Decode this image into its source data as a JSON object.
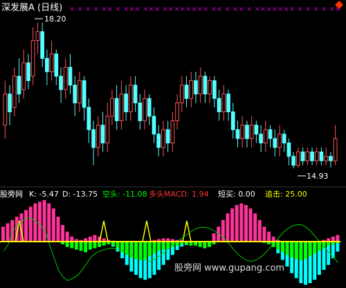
{
  "upper_panel": {
    "title": "深发展A (日线)",
    "high_label": "18.20",
    "low_label": "14.93",
    "markers": "× × × ×   ×× × ××× ××× ×××××××× ××  × ×× × ××××××× × × × × ××",
    "menu_icon": "diamond-menu-icon",
    "candles": [
      {
        "o": 15.9,
        "c": 16.6,
        "h": 16.9,
        "l": 15.6,
        "up": true
      },
      {
        "o": 16.6,
        "c": 16.2,
        "h": 16.8,
        "l": 15.9,
        "up": false
      },
      {
        "o": 16.3,
        "c": 17.0,
        "h": 17.2,
        "l": 16.1,
        "up": true
      },
      {
        "o": 17.0,
        "c": 16.6,
        "h": 17.4,
        "l": 16.4,
        "up": false
      },
      {
        "o": 16.7,
        "c": 17.3,
        "h": 17.6,
        "l": 16.5,
        "up": true
      },
      {
        "o": 17.3,
        "c": 16.9,
        "h": 17.5,
        "l": 16.7,
        "up": false
      },
      {
        "o": 17.0,
        "c": 17.8,
        "h": 18.1,
        "l": 16.8,
        "up": true
      },
      {
        "o": 17.8,
        "c": 18.0,
        "h": 18.2,
        "l": 17.5,
        "up": true
      },
      {
        "o": 18.0,
        "c": 17.4,
        "h": 18.2,
        "l": 17.2,
        "up": false
      },
      {
        "o": 17.4,
        "c": 17.1,
        "h": 17.6,
        "l": 16.8,
        "up": false
      },
      {
        "o": 17.1,
        "c": 17.5,
        "h": 17.8,
        "l": 16.9,
        "up": true
      },
      {
        "o": 17.5,
        "c": 17.0,
        "h": 17.6,
        "l": 16.8,
        "up": false
      },
      {
        "o": 17.0,
        "c": 16.7,
        "h": 17.2,
        "l": 16.4,
        "up": false
      },
      {
        "o": 16.7,
        "c": 17.2,
        "h": 17.4,
        "l": 16.5,
        "up": true
      },
      {
        "o": 17.2,
        "c": 16.8,
        "h": 17.5,
        "l": 16.6,
        "up": false
      },
      {
        "o": 16.8,
        "c": 16.4,
        "h": 17.0,
        "l": 16.1,
        "up": false
      },
      {
        "o": 16.4,
        "c": 16.9,
        "h": 17.1,
        "l": 16.2,
        "up": true
      },
      {
        "o": 16.9,
        "c": 16.3,
        "h": 17.0,
        "l": 16.0,
        "up": false
      },
      {
        "o": 16.3,
        "c": 15.8,
        "h": 16.5,
        "l": 15.5,
        "up": false
      },
      {
        "o": 15.8,
        "c": 15.4,
        "h": 16.0,
        "l": 15.0,
        "up": false
      },
      {
        "o": 15.4,
        "c": 15.9,
        "h": 16.1,
        "l": 15.2,
        "up": true
      },
      {
        "o": 15.9,
        "c": 15.5,
        "h": 16.2,
        "l": 15.3,
        "up": false
      },
      {
        "o": 15.5,
        "c": 16.1,
        "h": 16.4,
        "l": 15.3,
        "up": true
      },
      {
        "o": 16.1,
        "c": 16.5,
        "h": 16.7,
        "l": 15.9,
        "up": true
      },
      {
        "o": 16.5,
        "c": 16.0,
        "h": 16.8,
        "l": 15.8,
        "up": false
      },
      {
        "o": 16.0,
        "c": 16.6,
        "h": 16.9,
        "l": 15.8,
        "up": true
      },
      {
        "o": 16.6,
        "c": 16.2,
        "h": 16.8,
        "l": 16.0,
        "up": false
      },
      {
        "o": 16.2,
        "c": 16.8,
        "h": 17.0,
        "l": 16.0,
        "up": true
      },
      {
        "o": 16.8,
        "c": 16.4,
        "h": 17.0,
        "l": 16.2,
        "up": false
      },
      {
        "o": 16.4,
        "c": 16.0,
        "h": 16.6,
        "l": 15.8,
        "up": false
      },
      {
        "o": 16.0,
        "c": 16.5,
        "h": 16.7,
        "l": 15.8,
        "up": true
      },
      {
        "o": 16.5,
        "c": 16.1,
        "h": 16.6,
        "l": 15.9,
        "up": false
      },
      {
        "o": 16.1,
        "c": 15.7,
        "h": 16.3,
        "l": 15.5,
        "up": false
      },
      {
        "o": 15.7,
        "c": 15.4,
        "h": 15.9,
        "l": 15.2,
        "up": false
      },
      {
        "o": 15.4,
        "c": 15.8,
        "h": 16.0,
        "l": 15.2,
        "up": true
      },
      {
        "o": 15.8,
        "c": 15.5,
        "h": 16.0,
        "l": 15.3,
        "up": false
      },
      {
        "o": 15.5,
        "c": 16.0,
        "h": 16.2,
        "l": 15.3,
        "up": true
      },
      {
        "o": 16.0,
        "c": 16.4,
        "h": 16.6,
        "l": 15.8,
        "up": true
      },
      {
        "o": 16.4,
        "c": 16.8,
        "h": 17.0,
        "l": 16.2,
        "up": true
      },
      {
        "o": 16.8,
        "c": 16.5,
        "h": 17.0,
        "l": 16.3,
        "up": false
      },
      {
        "o": 16.5,
        "c": 16.9,
        "h": 17.1,
        "l": 16.3,
        "up": true
      },
      {
        "o": 16.9,
        "c": 16.6,
        "h": 17.1,
        "l": 16.4,
        "up": false
      },
      {
        "o": 16.6,
        "c": 17.0,
        "h": 17.2,
        "l": 16.4,
        "up": true
      },
      {
        "o": 17.0,
        "c": 16.6,
        "h": 17.1,
        "l": 16.4,
        "up": false
      },
      {
        "o": 16.6,
        "c": 16.9,
        "h": 17.0,
        "l": 16.4,
        "up": true
      },
      {
        "o": 16.9,
        "c": 16.5,
        "h": 17.0,
        "l": 16.3,
        "up": false
      },
      {
        "o": 16.5,
        "c": 16.2,
        "h": 16.7,
        "l": 16.0,
        "up": false
      },
      {
        "o": 16.2,
        "c": 16.6,
        "h": 16.8,
        "l": 16.0,
        "up": true
      },
      {
        "o": 16.6,
        "c": 16.2,
        "h": 16.7,
        "l": 16.0,
        "up": false
      },
      {
        "o": 16.2,
        "c": 15.8,
        "h": 16.4,
        "l": 15.6,
        "up": false
      },
      {
        "o": 15.8,
        "c": 15.6,
        "h": 16.0,
        "l": 15.4,
        "up": false
      },
      {
        "o": 15.6,
        "c": 15.9,
        "h": 16.1,
        "l": 15.4,
        "up": true
      },
      {
        "o": 15.9,
        "c": 15.6,
        "h": 16.0,
        "l": 15.4,
        "up": false
      },
      {
        "o": 15.6,
        "c": 15.9,
        "h": 16.1,
        "l": 15.4,
        "up": true
      },
      {
        "o": 15.9,
        "c": 15.7,
        "h": 16.0,
        "l": 15.5,
        "up": false
      },
      {
        "o": 15.7,
        "c": 15.5,
        "h": 15.9,
        "l": 15.3,
        "up": false
      },
      {
        "o": 15.5,
        "c": 15.8,
        "h": 16.0,
        "l": 15.3,
        "up": true
      },
      {
        "o": 15.8,
        "c": 15.6,
        "h": 15.9,
        "l": 15.4,
        "up": false
      },
      {
        "o": 15.6,
        "c": 15.4,
        "h": 15.8,
        "l": 15.2,
        "up": false
      },
      {
        "o": 15.4,
        "c": 15.7,
        "h": 15.9,
        "l": 15.2,
        "up": true
      },
      {
        "o": 15.7,
        "c": 15.5,
        "h": 15.8,
        "l": 15.3,
        "up": false
      },
      {
        "o": 15.5,
        "c": 15.2,
        "h": 15.6,
        "l": 15.0,
        "up": false
      },
      {
        "o": 15.2,
        "c": 15.0,
        "h": 15.3,
        "l": 14.93,
        "up": false
      },
      {
        "o": 15.0,
        "c": 15.3,
        "h": 15.4,
        "l": 14.95,
        "up": true
      },
      {
        "o": 15.3,
        "c": 15.1,
        "h": 15.4,
        "l": 15.0,
        "up": false
      },
      {
        "o": 15.1,
        "c": 15.3,
        "h": 15.4,
        "l": 15.0,
        "up": true
      },
      {
        "o": 15.3,
        "c": 15.1,
        "h": 15.4,
        "l": 15.0,
        "up": false
      },
      {
        "o": 15.1,
        "c": 15.3,
        "h": 15.4,
        "l": 15.0,
        "up": true
      },
      {
        "o": 15.3,
        "c": 15.1,
        "h": 15.4,
        "l": 15.0,
        "up": false
      },
      {
        "o": 15.1,
        "c": 15.2,
        "h": 15.4,
        "l": 15.0,
        "up": true
      },
      {
        "o": 15.2,
        "c": 15.1,
        "h": 15.3,
        "l": 14.95,
        "up": false
      },
      {
        "o": 15.1,
        "c": 15.6,
        "h": 15.9,
        "l": 15.0,
        "up": true
      }
    ],
    "price_range": [
      14.7,
      18.4
    ]
  },
  "lower_panel": {
    "indicator_name": "股旁网",
    "k_label": "K: -5.47",
    "d_label": "D: -13.75",
    "kongtou_label": "空头: -11.08",
    "duotou_label": "多头MACD: 1.94",
    "duanmai_label": "短买: 0.00",
    "zhuiji_label": "追击: 25.00",
    "colors": {
      "k": "#ffffff",
      "kongtou": "#00ff00",
      "duotou": "#ff3333",
      "pos_bar": "#ff3399",
      "neg_bar": "#00ffff",
      "green_bar": "#00ff00",
      "yellow_line": "#ffff00",
      "green_line": "#00cc00",
      "red_block": "#ff0000"
    },
    "series": {
      "pos_hist": [
        18,
        22,
        26,
        30,
        34,
        38,
        42,
        46,
        48,
        50,
        46,
        40,
        30,
        20,
        12,
        6,
        3,
        2,
        4,
        6,
        8,
        6,
        4,
        2,
        1,
        0,
        0,
        0,
        0,
        0,
        0,
        0,
        0,
        2,
        3,
        4,
        4,
        3,
        2,
        2,
        1,
        0,
        0,
        0,
        0,
        0,
        10,
        18,
        26,
        34,
        40,
        44,
        46,
        44,
        40,
        34,
        26,
        18,
        12,
        6,
        2,
        0,
        0,
        0,
        0,
        0,
        0,
        0,
        0,
        0,
        2,
        4,
        6,
        8
      ],
      "neg_hist": [
        0,
        0,
        0,
        0,
        0,
        0,
        0,
        0,
        0,
        0,
        0,
        0,
        0,
        0,
        0,
        0,
        0,
        0,
        0,
        0,
        0,
        0,
        0,
        0,
        6,
        12,
        20,
        28,
        36,
        40,
        44,
        46,
        44,
        40,
        34,
        28,
        22,
        16,
        10,
        6,
        4,
        2,
        0,
        0,
        0,
        0,
        0,
        0,
        0,
        0,
        0,
        0,
        0,
        0,
        0,
        0,
        0,
        0,
        0,
        6,
        14,
        22,
        30,
        38,
        44,
        50,
        52,
        50,
        46,
        40,
        34,
        28,
        20,
        12
      ],
      "green_hist": [
        0,
        0,
        0,
        0,
        0,
        0,
        0,
        0,
        0,
        0,
        0,
        0,
        0,
        4,
        8,
        10,
        12,
        14,
        16,
        12,
        10,
        8,
        6,
        4,
        6,
        10,
        16,
        20,
        24,
        26,
        28,
        26,
        22,
        18,
        14,
        12,
        10,
        8,
        6,
        4,
        4,
        6,
        6,
        8,
        10,
        8,
        4,
        0,
        0,
        0,
        0,
        0,
        0,
        0,
        0,
        0,
        0,
        2,
        4,
        8,
        12,
        16,
        20,
        24,
        26,
        28,
        26,
        22,
        18,
        14,
        10,
        6,
        4,
        2
      ],
      "green_line": [
        70,
        60,
        40,
        30,
        25,
        20,
        20,
        25,
        30,
        40,
        60,
        80,
        100,
        110,
        115,
        112,
        108,
        100,
        90,
        80,
        74,
        70,
        68,
        66,
        66,
        68,
        70,
        74,
        78,
        80,
        82,
        84,
        86,
        82,
        78,
        72,
        66,
        60,
        55,
        50,
        45,
        40,
        36,
        34,
        34,
        36,
        40,
        44,
        50,
        58,
        66,
        74,
        80,
        84,
        86,
        84,
        80,
        74,
        66,
        58,
        50,
        42,
        36,
        32,
        30,
        30,
        34,
        40,
        48,
        56,
        64,
        72,
        80,
        88
      ]
    },
    "watermark": "股旁网 www.gupang.com"
  }
}
